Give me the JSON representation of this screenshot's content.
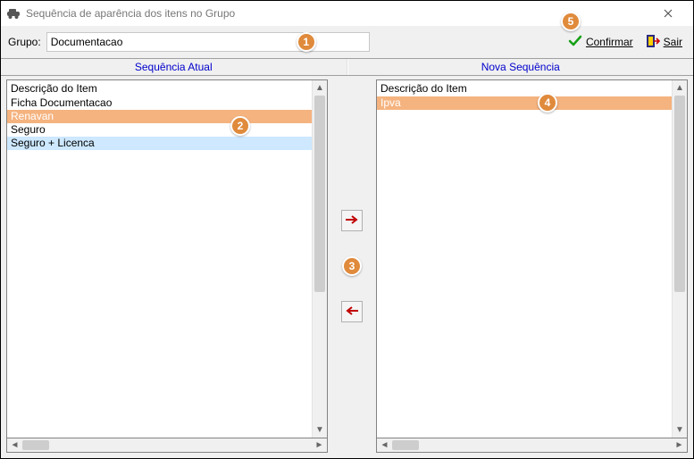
{
  "window": {
    "title": "Sequência de aparência dos itens no Grupo"
  },
  "group": {
    "label": "Grupo:",
    "value": "Documentacao"
  },
  "actions": {
    "confirm": "Confirmar",
    "exit": "Sair"
  },
  "headers": {
    "left": "Sequência Atual",
    "right": "Nova Sequência"
  },
  "columns": {
    "left": "Descrição do Item",
    "right": "Descrição do Item"
  },
  "left_list": {
    "items": [
      "Ficha Documentacao",
      "Renavan",
      "Seguro",
      "Seguro + Licenca"
    ],
    "selected_orange_index": 1,
    "selected_blue_index": 3
  },
  "right_list": {
    "items": [
      "Ipva"
    ],
    "selected_orange_index": 0
  },
  "badges": {
    "b1": "1",
    "b2": "2",
    "b3": "3",
    "b4": "4",
    "b5": "5"
  }
}
